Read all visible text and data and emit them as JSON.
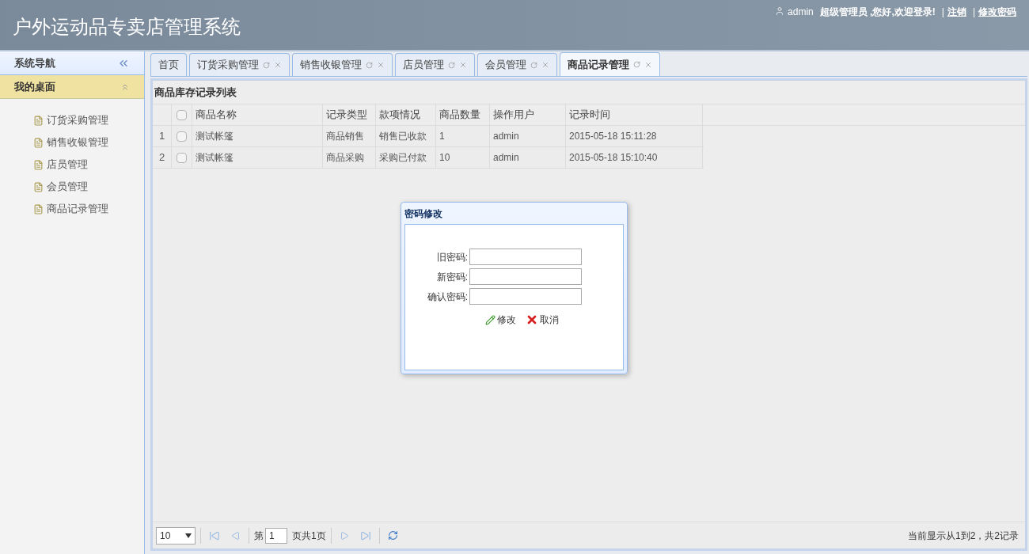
{
  "header": {
    "title": "户外运动品专卖店管理系统",
    "user": "admin",
    "greeting": "超级管理员 ,您好,欢迎登录!",
    "links": [
      {
        "kind": "sep",
        "text": "|"
      },
      {
        "kind": "link",
        "text": "注销"
      },
      {
        "kind": "sep",
        "text": "|"
      },
      {
        "kind": "link",
        "text": "修改密码"
      }
    ]
  },
  "sidebar": {
    "title": "系统导航",
    "section": {
      "title": "我的桌面",
      "expanded": true
    },
    "items": [
      "订货采购管理",
      "销售收银管理",
      "店员管理",
      "会员管理",
      "商品记录管理"
    ]
  },
  "tabs": [
    {
      "label": "首页",
      "closable": false,
      "selected": false
    },
    {
      "label": "订货采购管理",
      "closable": true,
      "selected": false
    },
    {
      "label": "销售收银管理",
      "closable": true,
      "selected": false
    },
    {
      "label": "店员管理",
      "closable": true,
      "selected": false
    },
    {
      "label": "会员管理",
      "closable": true,
      "selected": false
    },
    {
      "label": "商品记录管理",
      "closable": true,
      "selected": true
    }
  ],
  "grid": {
    "title": "商品库存记录列表",
    "header_checked": false,
    "columns": [
      "商品名称",
      "记录类型",
      "款项情况",
      "商品数量",
      "操作用户",
      "记录时间"
    ],
    "rows": [
      {
        "num": "1",
        "checked": false,
        "cells": [
          "测试帐篷",
          "商品销售",
          "销售已收款",
          "1",
          "admin",
          "2015-05-18 15:11:28"
        ]
      },
      {
        "num": "2",
        "checked": false,
        "cells": [
          "测试帐篷",
          "商品采购",
          "采购已付款",
          "10",
          "admin",
          "2015-05-18 15:10:40"
        ]
      }
    ]
  },
  "pager": {
    "page_size": "10",
    "before": "第",
    "page": "1",
    "after": "页共1页",
    "summary": "当前显示从1到2，共2记录"
  },
  "dialog": {
    "title": "密码修改",
    "fields": [
      {
        "label": "旧密码:"
      },
      {
        "label": "新密码:"
      },
      {
        "label": "确认密码:"
      }
    ],
    "buttons": [
      {
        "kind": "edit",
        "label": "修改"
      },
      {
        "kind": "cancel",
        "label": "取消"
      }
    ]
  }
}
